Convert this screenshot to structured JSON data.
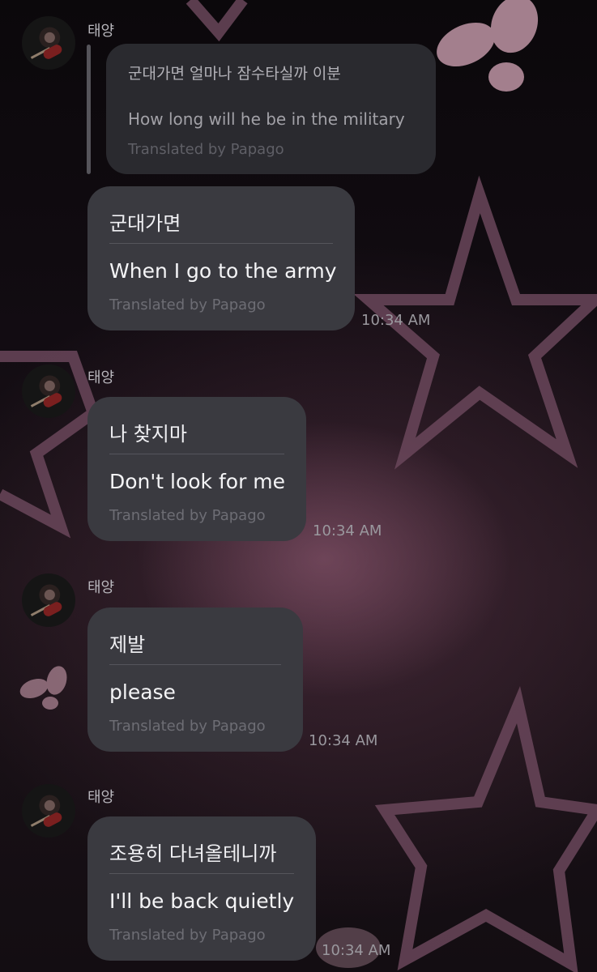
{
  "chat": {
    "sender_name": "태양",
    "reply_preview": {
      "original": "군대가면 얼마나 잠수타실까 이분",
      "translation": "How long will he be in the military",
      "credit": "Translated by Papago"
    },
    "messages": [
      {
        "original": "군대가면",
        "translation": "When I go to the army",
        "credit": "Translated by Papago",
        "time": "10:34 AM"
      },
      {
        "original": "나 찾지마",
        "translation": "Don't look for me",
        "credit": "Translated by Papago",
        "time": "10:34 AM"
      },
      {
        "original": "제발",
        "translation": "please",
        "credit": "Translated by Papago",
        "time": "10:34 AM"
      },
      {
        "original": "조용히 다녀올테니까",
        "translation": "I'll be back quietly",
        "credit": "Translated by Papago",
        "time": "10:34 AM"
      }
    ]
  },
  "colors": {
    "bubble": "#3a3a40",
    "reply_bubble": "#2a2a2f",
    "star_outline": "#6c4a5d",
    "butterfly": "#e8b8c8"
  },
  "icons": [
    "avatar-photo",
    "star-decoration",
    "butterfly-decoration"
  ]
}
